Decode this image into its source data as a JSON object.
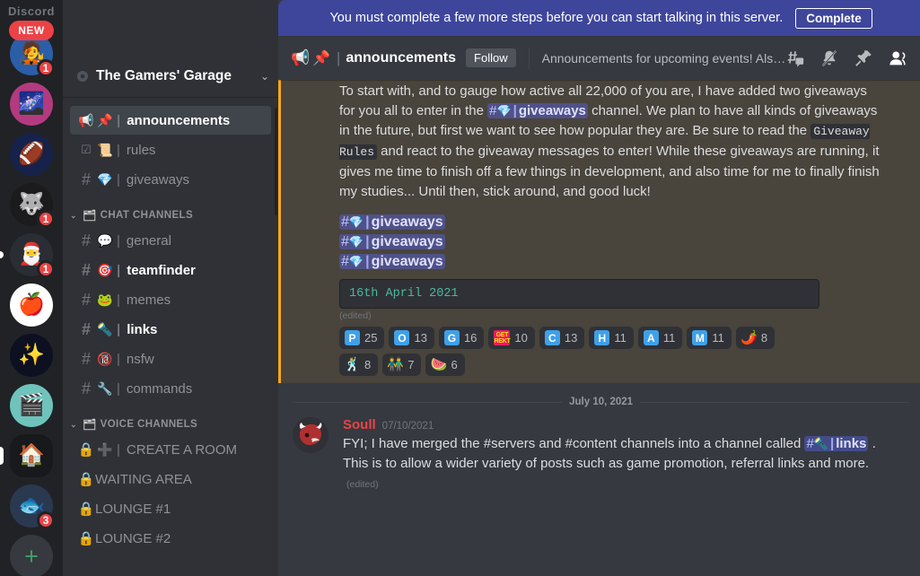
{
  "rail": {
    "wordmark": "Discord",
    "new_badge": "NEW",
    "add_server_label": "+",
    "servers": [
      {
        "name": "anime-blue-hair-server",
        "emoji": "🧑‍🎤",
        "badge": "1",
        "shape": "circle",
        "bg": "#2b5ea8",
        "pip": ""
      },
      {
        "name": "galaxy-art-server",
        "emoji": "🌌",
        "badge": "",
        "shape": "circle",
        "bg": "#b43a80",
        "pip": ""
      },
      {
        "name": "fantasy-football-chat-server",
        "emoji": "🏈",
        "badge": "",
        "shape": "circle",
        "bg": "#17224a",
        "pip": ""
      },
      {
        "name": "tcc-server",
        "emoji": "🐺",
        "badge": "1",
        "shape": "circle",
        "bg": "#1b1b1e",
        "pip": ""
      },
      {
        "name": "santa-hat-anime-server",
        "emoji": "🎅",
        "badge": "1",
        "shape": "circle",
        "bg": "#2a2d33",
        "pip": "dot"
      },
      {
        "name": "red-apple-logo-server",
        "emoji": "🍎",
        "badge": "",
        "shape": "circle",
        "bg": "#ffffff",
        "pip": ""
      },
      {
        "name": "marvel-studios-server",
        "emoji": "✨",
        "badge": "",
        "shape": "circle",
        "bg": "#0d1021",
        "pip": ""
      },
      {
        "name": "clapperboard-server",
        "emoji": "🎬",
        "badge": "",
        "shape": "circle",
        "bg": "#6fc3bd",
        "pip": ""
      },
      {
        "name": "gamers-garage-server",
        "emoji": "🏠",
        "badge": "",
        "shape": "square",
        "bg": "#17191c",
        "pip": "tall"
      },
      {
        "name": "monster-gaming-server",
        "emoji": "🐟",
        "badge": "3",
        "shape": "circle",
        "bg": "#2a3950",
        "pip": ""
      }
    ]
  },
  "sidebar": {
    "server_name": "The Gamers' Garage",
    "sections": [
      {
        "name": "",
        "label": "",
        "channels": [
          {
            "icon": "announcement",
            "emoji": "📌",
            "name": "announcements",
            "state": "active",
            "bar": true
          },
          {
            "icon": "rules",
            "emoji": "📜",
            "name": "rules",
            "state": "normal",
            "bar": true
          },
          {
            "icon": "hash",
            "emoji": "💎",
            "name": "giveaways",
            "state": "normal",
            "bar": true
          }
        ]
      },
      {
        "name": "chat-channels",
        "label": "CHAT CHANNELS",
        "channels": [
          {
            "icon": "hash",
            "emoji": "💬",
            "name": "general",
            "state": "normal",
            "bar": true
          },
          {
            "icon": "hash",
            "emoji": "🎯",
            "name": "teamfinder",
            "state": "unread",
            "bar": true
          },
          {
            "icon": "hash",
            "emoji": "🐸",
            "name": "memes",
            "state": "normal",
            "bar": true
          },
          {
            "icon": "hash",
            "emoji": "🔦",
            "name": "links",
            "state": "unread",
            "bar": true
          },
          {
            "icon": "hash-nsfw",
            "emoji": "🔞",
            "name": "nsfw",
            "state": "normal",
            "bar": true
          },
          {
            "icon": "hash",
            "emoji": "🔧",
            "name": "commands",
            "state": "normal",
            "bar": true
          }
        ]
      },
      {
        "name": "voice-channels",
        "label": "VOICE CHANNELS",
        "channels": [
          {
            "icon": "lock",
            "emoji": "➕",
            "name": "CREATE A ROOM",
            "state": "normal",
            "bar": true
          },
          {
            "icon": "lock",
            "emoji": "",
            "name": "WAITING AREA",
            "state": "normal",
            "bar": false
          },
          {
            "icon": "lock",
            "emoji": "",
            "name": "LOUNGE #1",
            "state": "normal",
            "bar": false
          },
          {
            "icon": "lock",
            "emoji": "",
            "name": "LOUNGE #2",
            "state": "normal",
            "bar": false
          }
        ]
      }
    ]
  },
  "banner": {
    "text": "You must complete a few more steps before you can start talking in this server.",
    "button": "Complete",
    "color": "#3e469c"
  },
  "channel_header": {
    "emoji": "📌",
    "name": "announcements",
    "follow_label": "Follow",
    "topic": "Announcements for upcoming events! Als…",
    "icons": [
      "create-thread-icon",
      "notifications-muted-icon",
      "pinned-messages-icon",
      "member-list-icon"
    ]
  },
  "messages": {
    "pinned_message": {
      "paragraph_1a": "To start with, and to gauge how active all 22,000 of you are, I have added two giveaways for you all to enter in the ",
      "channel_mention": {
        "hash": "#",
        "emoji": "💎",
        "sep": "|",
        "name": "giveaways"
      },
      "paragraph_1b": " channel. We plan to have all kinds of giveaways in the future, but first we want to see how popular they are. Be sure to read the ",
      "code_inline": "Giveaway Rules",
      "paragraph_1c": " and react to the giveaway messages to enter! While these giveaways are running, it gives me time to finish off a few things in development, and also time for me to finally finish my studies... Until then, stick around, and good luck!",
      "mention_lines": [
        {
          "hash": "#",
          "emoji": "💎",
          "sep": "|",
          "name": "giveaways"
        },
        {
          "hash": "#",
          "emoji": "💎",
          "sep": "|",
          "name": "giveaways"
        },
        {
          "hash": "#",
          "emoji": "💎",
          "sep": "|",
          "name": "giveaways"
        }
      ],
      "codeblock": "16th April 2021",
      "edited": "(edited)",
      "reactions": [
        {
          "kind": "letter",
          "glyph": "P",
          "name": "letter-p-emoji",
          "count": "25"
        },
        {
          "kind": "letter",
          "glyph": "O",
          "name": "letter-o-emoji",
          "count": "13"
        },
        {
          "kind": "letter",
          "glyph": "G",
          "name": "letter-g-emoji",
          "count": "16"
        },
        {
          "kind": "rekt",
          "glyph": "GET REKT",
          "name": "get-rekt-emoji",
          "count": "10"
        },
        {
          "kind": "letter",
          "glyph": "C",
          "name": "letter-c-emoji",
          "count": "13"
        },
        {
          "kind": "letter",
          "glyph": "H",
          "name": "letter-h-emoji",
          "count": "11"
        },
        {
          "kind": "letter",
          "glyph": "A",
          "name": "letter-a-emoji",
          "count": "11"
        },
        {
          "kind": "letter",
          "glyph": "M",
          "name": "letter-m-emoji",
          "count": "11"
        },
        {
          "kind": "emoji",
          "glyph": "🌶️",
          "name": "chili-pepper-emoji",
          "count": "8"
        },
        {
          "kind": "emoji",
          "glyph": "🕺",
          "name": "dabbing-unicorn-emoji",
          "count": "8"
        },
        {
          "kind": "emoji",
          "glyph": "👬",
          "name": "two-people-emoji",
          "count": "7"
        },
        {
          "kind": "emoji",
          "glyph": "🍉",
          "name": "watermelon-emoji",
          "count": "6"
        }
      ]
    },
    "date_divider": "July 10, 2021",
    "soull_message": {
      "author": "Soull",
      "timestamp": "07/10/2021",
      "text_a": "FYI; I have merged the #servers and #content channels into a channel called ",
      "channel_mention": {
        "hash": "#",
        "emoji": "🔦",
        "sep": "|",
        "name": "links"
      },
      "text_b": " . This is to allow a wider variety of posts such as game promotion, referral links and more.",
      "edited": "(edited)"
    }
  }
}
